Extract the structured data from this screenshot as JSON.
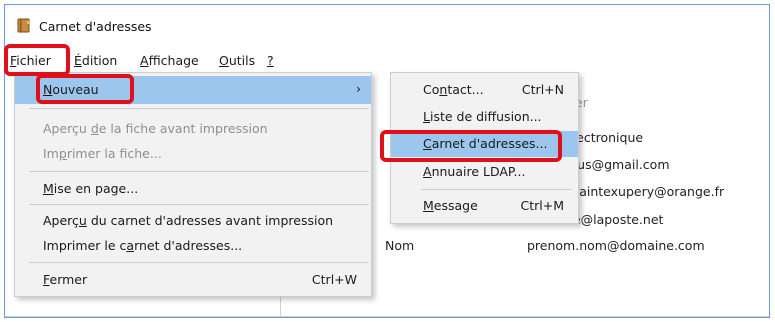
{
  "window": {
    "title": "Carnet d'adresses"
  },
  "menubar": {
    "items": [
      {
        "pre": "",
        "u": "F",
        "post": "ichier"
      },
      {
        "pre": "",
        "u": "É",
        "post": "dition"
      },
      {
        "pre": "",
        "u": "A",
        "post": "ffichage"
      },
      {
        "pre": "",
        "u": "O",
        "post": "utils"
      },
      {
        "pre": "",
        "u": "?",
        "post": ""
      }
    ]
  },
  "list": {
    "column_header_partial": "er",
    "rows": [
      {
        "name": "",
        "email": "électronique"
      },
      {
        "name": "",
        "email": "mus@gmail.com"
      },
      {
        "name": "",
        "email": "esaintexupery@orange.fr"
      },
      {
        "name": "",
        "email": "ne@laposte.net"
      },
      {
        "name": "Nom",
        "email": "prenom.nom@domaine.com"
      }
    ]
  },
  "fichier_menu": {
    "nouveau": {
      "pre": "",
      "u": "N",
      "post": "ouveau",
      "arrow": "›"
    },
    "apercu_fiche": {
      "pre": "Aperçu ",
      "u": "d",
      "post": "e la fiche avant impression"
    },
    "imprimer_fiche": {
      "pre": "Im",
      "u": "p",
      "post": "rimer la fiche..."
    },
    "mise_en_page": {
      "pre": "",
      "u": "M",
      "post": "ise en page..."
    },
    "apercu_carnet": {
      "pre": "Aperç",
      "u": "u",
      "post": " du carnet d'adresses avant impression"
    },
    "imprimer_carnet": {
      "pre": "Imprimer le c",
      "u": "a",
      "post": "rnet d'adresses..."
    },
    "fermer": {
      "pre": "",
      "u": "F",
      "post": "ermer",
      "shortcut": "Ctrl+W"
    }
  },
  "nouveau_submenu": {
    "contact": {
      "pre": "Co",
      "u": "n",
      "post": "tact...",
      "shortcut": "Ctrl+N"
    },
    "liste": {
      "pre": "",
      "u": "L",
      "post": "iste de diffusion..."
    },
    "carnet": {
      "pre": "",
      "u": "C",
      "post": "arnet d'adresses..."
    },
    "annuaire": {
      "pre": "",
      "u": "A",
      "post": "nnuaire LDAP..."
    },
    "message": {
      "pre": "",
      "u": "M",
      "post": "essage",
      "shortcut": "Ctrl+M"
    }
  },
  "colors": {
    "highlight": "#9dc6ef",
    "annotation_red": "#e0101a",
    "window_border": "#6a9ad8"
  },
  "icons": {
    "app": "address-book-icon",
    "submenu_arrow": "chevron-right-icon"
  }
}
